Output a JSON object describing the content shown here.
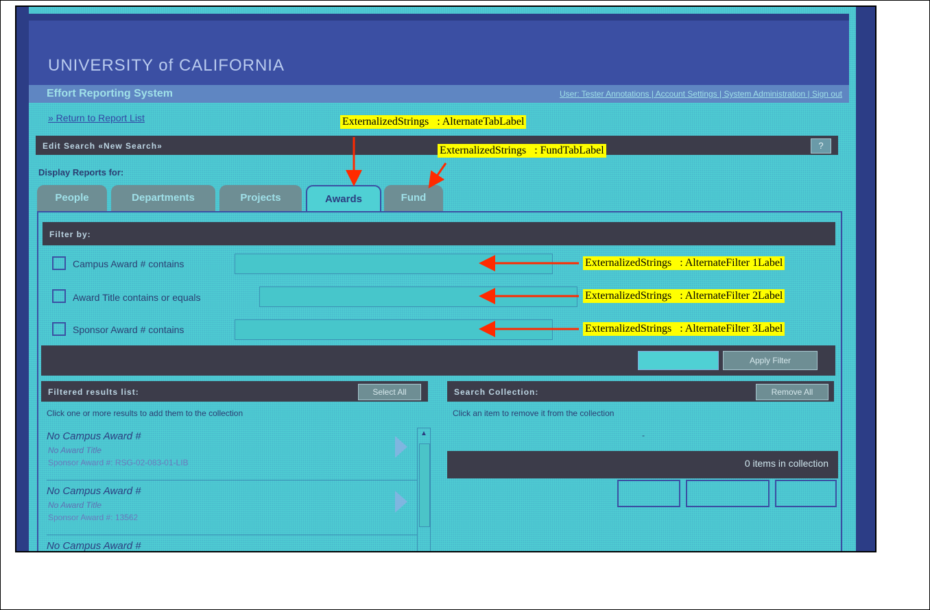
{
  "app": {
    "title": "UNIVERSITY of CALIFORNIA",
    "system_name": "Effort Reporting System",
    "top_links": "User: Tester Annotations | Account Settings | System Administration | Sign out",
    "return_link": "» Return to Report List"
  },
  "edit_search": {
    "title": "Edit Search «New Search»",
    "help_label": "?"
  },
  "display_label": "Display Reports for:",
  "tabs": [
    {
      "label": "People",
      "active": false
    },
    {
      "label": "Departments",
      "active": false
    },
    {
      "label": "Projects",
      "active": false
    },
    {
      "label": "Awards",
      "active": true
    },
    {
      "label": "Fund",
      "active": false
    }
  ],
  "filter": {
    "title": "Filter by:",
    "rows": [
      {
        "label": "Campus Award # contains",
        "value": ""
      },
      {
        "label": "Award Title contains or equals",
        "value": ""
      },
      {
        "label": "Sponsor Award # contains",
        "value": ""
      }
    ],
    "apply_value": "",
    "apply_button": "Apply Filter"
  },
  "results": {
    "title": "Filtered results list:",
    "select_all": "Select All",
    "hint": "Click one or more results to add them to the collection",
    "items": [
      {
        "campus_award": "No Campus Award #",
        "award_title": "No Award Title",
        "sponsor_award": "Sponsor Award #: RSG-02-083-01-LIB"
      },
      {
        "campus_award": "No Campus Award #",
        "award_title": "No Award Title",
        "sponsor_award": "Sponsor Award #: 13562"
      },
      {
        "campus_award": "No Campus Award #",
        "award_title": "",
        "sponsor_award": ""
      }
    ]
  },
  "collection": {
    "title": "Search Collection:",
    "remove_all": "Remove All",
    "hint": "Click an item to remove it from the collection",
    "dash": "-",
    "count_text": "0 items in collection"
  },
  "annotations": {
    "alternate_tab": "ExternalizedStrings   : AlternateTabLabel",
    "fund_tab": "ExternalizedStrings   : FundTabLabel",
    "filter1": "ExternalizedStrings   : AlternateFilter 1Label",
    "filter2": "ExternalizedStrings   : AlternateFilter 2Label",
    "filter3": "ExternalizedStrings   : AlternateFilter 3Label"
  },
  "colors": {
    "background": "#4fd0d4",
    "header": "#3b4fa3",
    "dark_bar": "#3c3c4a",
    "annotation_highlight": "#ffff00",
    "annotation_arrow": "#ff2a00"
  }
}
